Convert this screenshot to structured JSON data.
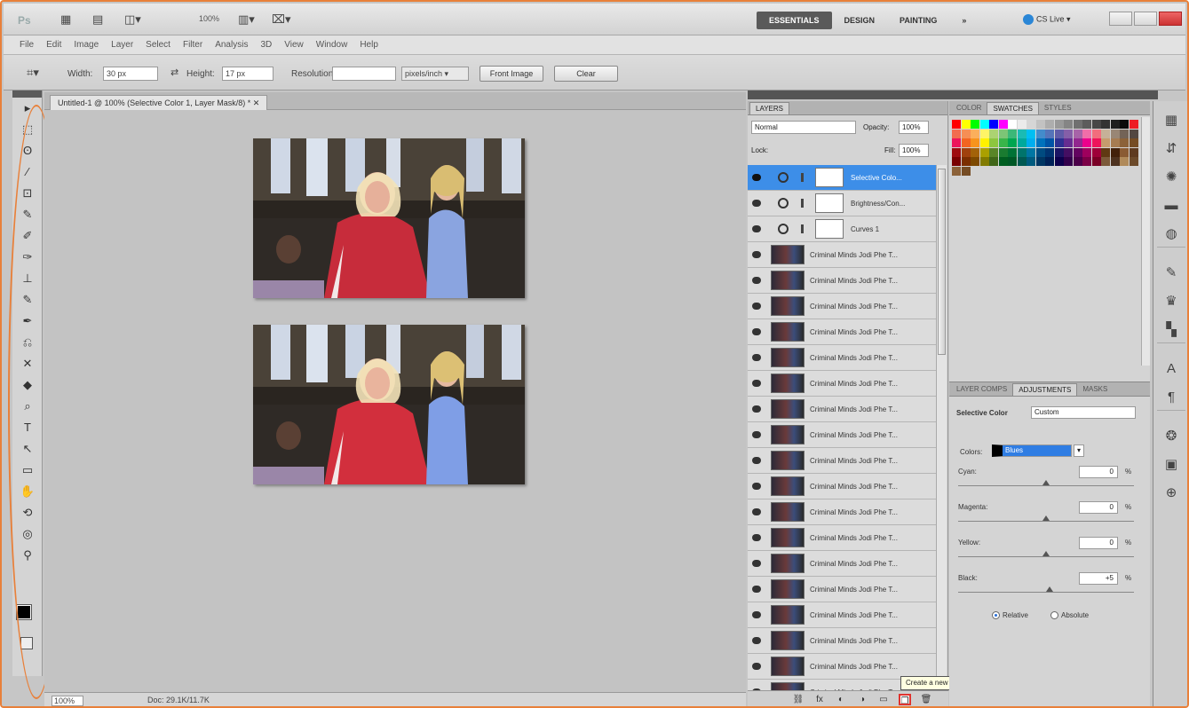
{
  "app": {
    "logo": "Ps",
    "zoom": "100%",
    "workspaces": [
      "ESSENTIALS",
      "DESIGN",
      "PAINTING",
      "»"
    ],
    "active_workspace": "ESSENTIALS",
    "cs_live": "CS Live ▾"
  },
  "menu": [
    "File",
    "Edit",
    "Image",
    "Layer",
    "Select",
    "Filter",
    "Analysis",
    "3D",
    "View",
    "Window",
    "Help"
  ],
  "options": {
    "width_label": "Width:",
    "width_value": "30 px",
    "height_label": "Height:",
    "height_value": "17 px",
    "resolution_label": "Resolution:",
    "resolution_value": "",
    "resolution_unit": "pixels/inch ▾",
    "front_image": "Front Image",
    "clear": "Clear"
  },
  "document": {
    "tab_title": "Untitled-1 @ 100% (Selective Color 1, Layer Mask/8) * ✕",
    "zoom": "100%",
    "doc_size": "Doc: 29.1K/11.7K"
  },
  "tools": [
    "▸",
    "⬚",
    "ʘ",
    "⁄",
    "⊡",
    "✎",
    "✐",
    "✑",
    "⊥",
    "✎",
    "✒",
    "⎌",
    "✕",
    "◆",
    "⌕",
    "T",
    "↖",
    "▭",
    "✋",
    "⟲",
    "◎",
    "⚲"
  ],
  "layers": {
    "tabs": [
      "LAYERS"
    ],
    "blend_mode": "Normal",
    "opacity_label": "Opacity:",
    "opacity": "100%",
    "lock_label": "Lock:",
    "fill_label": "Fill:",
    "fill": "100%",
    "adjustment_layers": [
      {
        "name": "Selective Colo...",
        "selected": true
      },
      {
        "name": "Brightness/Con...",
        "selected": false
      },
      {
        "name": "Curves 1",
        "selected": false
      }
    ],
    "pixel_layers": [
      "Criminal Minds Jodi Phe T...",
      "Criminal Minds Jodi Phe T...",
      "Criminal Minds Jodi Phe T...",
      "Criminal Minds Jodi Phe T...",
      "Criminal Minds Jodi Phe T...",
      "Criminal Minds Jodi Phe T...",
      "Criminal Minds Jodi Phe T...",
      "Criminal Minds Jodi Phe T...",
      "Criminal Minds Jodi Phe T...",
      "Criminal Minds Jodi Phe T...",
      "Criminal Minds Jodi Phe T...",
      "Criminal Minds Jodi Phe T...",
      "Criminal Minds Jodi Phe T...",
      "Criminal Minds Jodi Phe T...",
      "Criminal Minds Jodi Phe T...",
      "Criminal Minds Jodi Phe T...",
      "Criminal Minds Jodi Phe T...",
      "Criminal Minds Jodi Phe T..."
    ],
    "footer_icons": [
      "⛓",
      "fx",
      "◐",
      "◑",
      "▭",
      "❐",
      "🗑"
    ],
    "tooltip": "Create a new layer"
  },
  "swatches": {
    "tabs": [
      "COLOR",
      "SWATCHES",
      "STYLES"
    ],
    "active_tab": "SWATCHES",
    "colors": [
      "#ff0000",
      "#ffff00",
      "#00ff00",
      "#00ffff",
      "#0000ff",
      "#ff00ff",
      "#ffffff",
      "#ebebeb",
      "#d6d6d6",
      "#c2c2c2",
      "#adadad",
      "#999999",
      "#858585",
      "#707070",
      "#5c5c5c",
      "#474747",
      "#333333",
      "#1f1f1f",
      "#0a0a0a",
      "#ed1c24",
      "#f26c4f",
      "#f68e55",
      "#fbaf5c",
      "#fff467",
      "#acd372",
      "#7cc576",
      "#3bb878",
      "#1abbb4",
      "#00bff3",
      "#438ccb",
      "#5574b9",
      "#605ca8",
      "#855fa8",
      "#a763a8",
      "#f06ea9",
      "#f26d7d",
      "#c6b198",
      "#998675",
      "#736357",
      "#534741",
      "#ed145b",
      "#f26522",
      "#f7941d",
      "#fff200",
      "#8dc63f",
      "#39b54a",
      "#00a651",
      "#00a99d",
      "#00aeef",
      "#0072bc",
      "#0054a6",
      "#2e3192",
      "#662d91",
      "#92278f",
      "#ec008c",
      "#ed145b",
      "#c69c6d",
      "#a67c52",
      "#8c6239",
      "#754c24",
      "#9e0b0f",
      "#a0410d",
      "#a36209",
      "#aba000",
      "#598527",
      "#1a7b30",
      "#007236",
      "#00746b",
      "#0076a3",
      "#004b80",
      "#003471",
      "#1b1464",
      "#440e62",
      "#630460",
      "#9e005d",
      "#9e0039",
      "#603913",
      "#42210b",
      "#8a5b33",
      "#5e3a1f",
      "#790000",
      "#7b2e00",
      "#7d4900",
      "#827b00",
      "#406618",
      "#005e20",
      "#005826",
      "#005952",
      "#005b7f",
      "#003663",
      "#002157",
      "#0d004c",
      "#32004b",
      "#4b0049",
      "#7b0046",
      "#7a0026",
      "#7c5a3a",
      "#4e3320",
      "#b08a5a",
      "#6c4a2a"
    ],
    "extra": [
      "#8c6239",
      "#754c24"
    ]
  },
  "adjustments": {
    "tabs": [
      "LAYER COMPS",
      "ADJUSTMENTS",
      "MASKS"
    ],
    "active_tab": "ADJUSTMENTS",
    "title": "Selective Color",
    "preset": "Custom",
    "colors_label": "Colors:",
    "colors_value": "Blues",
    "fields": [
      {
        "label": "Cyan:",
        "value": "0",
        "unit": "%",
        "level": 0.5
      },
      {
        "label": "Magenta:",
        "value": "0",
        "unit": "%",
        "level": 0.5
      },
      {
        "label": "Yellow:",
        "value": "0",
        "unit": "%",
        "level": 0.5
      },
      {
        "label": "Black:",
        "value": "+5",
        "unit": "%",
        "level": 0.52
      }
    ],
    "relative_label": "Relative",
    "absolute_label": "Absolute",
    "method": "Relative"
  },
  "dock_icons": [
    "▦",
    "⇵",
    "✺",
    "▬",
    "◍",
    "✎",
    "♛",
    "▚",
    "A",
    "¶",
    "❂",
    "▣",
    "⊕"
  ]
}
